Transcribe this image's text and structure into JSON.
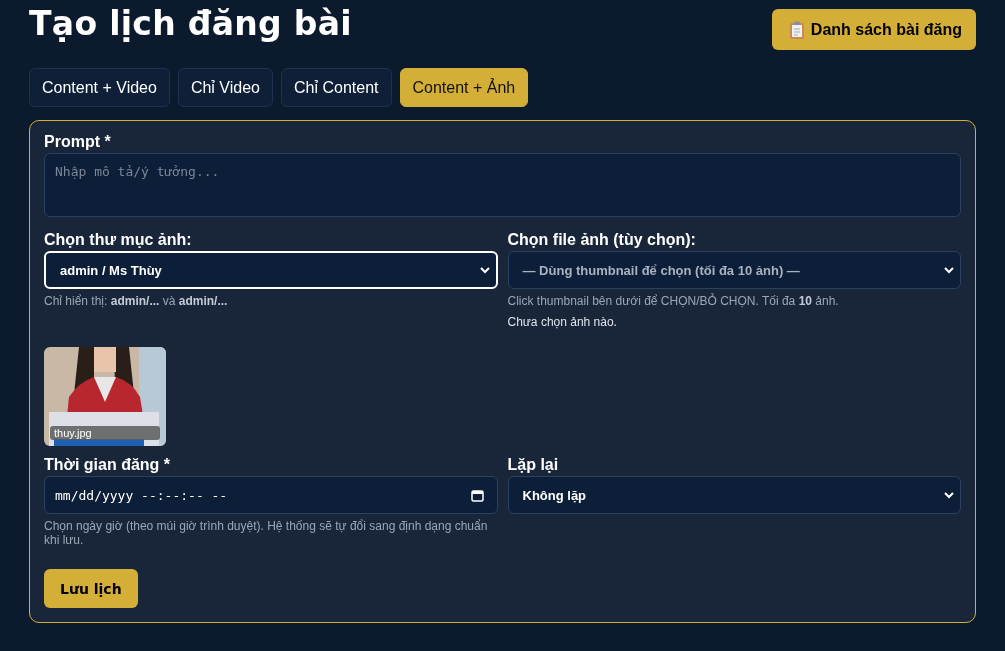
{
  "title": "Tạo lịch đăng bài",
  "list_button": {
    "label": "Danh sách bài đăng"
  },
  "tabs": [
    {
      "label": "Content + Video",
      "selected": false
    },
    {
      "label": "Chỉ Video",
      "selected": false
    },
    {
      "label": "Chỉ Content",
      "selected": false
    },
    {
      "label": "Content + Ảnh",
      "selected": true
    }
  ],
  "prompt": {
    "label": "Prompt *",
    "placeholder": "Nhập mô tả/ý tưởng..."
  },
  "folder": {
    "label": "Chọn thư mục ảnh:",
    "value": "admin / Ms Thùy",
    "focused": true,
    "hint": "Chỉ hiển thị: **admin/...** và **admin/...**"
  },
  "file": {
    "label": "Chọn file ảnh (tùy chọn):",
    "value": "— Dùng thumbnail để chọn (tối đa 10 ảnh) —",
    "focused": false,
    "hint": "Click thumbnail bên dưới để CHỌN/BỎ CHỌN. Tối đa **10** ảnh.",
    "status": "Chưa chọn ảnh nào."
  },
  "thumbnails": [
    {
      "kind": "picture",
      "caption": "thuy.jpg"
    }
  ],
  "time": {
    "label": "Thời gian đăng *",
    "placeholder": "mm/dd/yyyy --:--:-- --",
    "hint": "Chọn ngày giờ (theo múi giờ trình duyệt). Hệ thống sẽ tự đổi sang định dạng chuẩn khi lưu."
  },
  "repeat": {
    "label": "Lặp lại",
    "value": "Không lặp",
    "focused": false
  },
  "save_button": {
    "label": "Lưu lịch"
  }
}
